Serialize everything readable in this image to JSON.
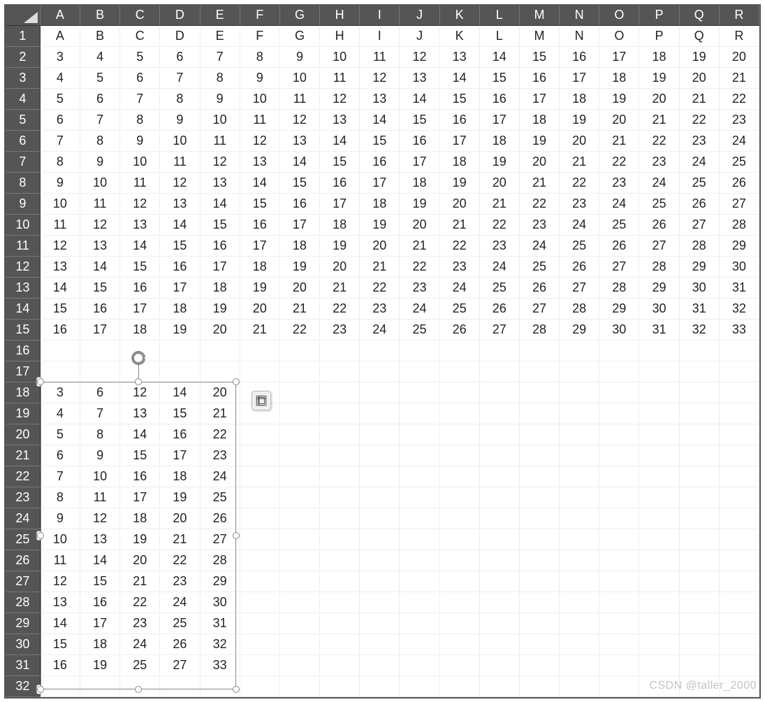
{
  "watermark": "CSDN @taller_2000",
  "columns": [
    "A",
    "B",
    "C",
    "D",
    "E",
    "F",
    "G",
    "H",
    "I",
    "J",
    "K",
    "L",
    "M",
    "N",
    "O",
    "P",
    "Q",
    "R"
  ],
  "rowNumbers": [
    1,
    2,
    3,
    4,
    5,
    6,
    7,
    8,
    9,
    10,
    11,
    12,
    13,
    14,
    15,
    16,
    17,
    18,
    19,
    20,
    21,
    22,
    23,
    24,
    25,
    26,
    27,
    28,
    29,
    30,
    31,
    32
  ],
  "grid": {
    "1": [
      "A",
      "B",
      "C",
      "D",
      "E",
      "F",
      "G",
      "H",
      "I",
      "J",
      "K",
      "L",
      "M",
      "N",
      "O",
      "P",
      "Q",
      "R"
    ],
    "2": [
      "3",
      "4",
      "5",
      "6",
      "7",
      "8",
      "9",
      "10",
      "11",
      "12",
      "13",
      "14",
      "15",
      "16",
      "17",
      "18",
      "19",
      "20"
    ],
    "3": [
      "4",
      "5",
      "6",
      "7",
      "8",
      "9",
      "10",
      "11",
      "12",
      "13",
      "14",
      "15",
      "16",
      "17",
      "18",
      "19",
      "20",
      "21"
    ],
    "4": [
      "5",
      "6",
      "7",
      "8",
      "9",
      "10",
      "11",
      "12",
      "13",
      "14",
      "15",
      "16",
      "17",
      "18",
      "19",
      "20",
      "21",
      "22"
    ],
    "5": [
      "6",
      "7",
      "8",
      "9",
      "10",
      "11",
      "12",
      "13",
      "14",
      "15",
      "16",
      "17",
      "18",
      "19",
      "20",
      "21",
      "22",
      "23"
    ],
    "6": [
      "7",
      "8",
      "9",
      "10",
      "11",
      "12",
      "13",
      "14",
      "15",
      "16",
      "17",
      "18",
      "19",
      "20",
      "21",
      "22",
      "23",
      "24"
    ],
    "7": [
      "8",
      "9",
      "10",
      "11",
      "12",
      "13",
      "14",
      "15",
      "16",
      "17",
      "18",
      "19",
      "20",
      "21",
      "22",
      "23",
      "24",
      "25"
    ],
    "8": [
      "9",
      "10",
      "11",
      "12",
      "13",
      "14",
      "15",
      "16",
      "17",
      "18",
      "19",
      "20",
      "21",
      "22",
      "23",
      "24",
      "25",
      "26"
    ],
    "9": [
      "10",
      "11",
      "12",
      "13",
      "14",
      "15",
      "16",
      "17",
      "18",
      "19",
      "20",
      "21",
      "22",
      "23",
      "24",
      "25",
      "26",
      "27"
    ],
    "10": [
      "11",
      "12",
      "13",
      "14",
      "15",
      "16",
      "17",
      "18",
      "19",
      "20",
      "21",
      "22",
      "23",
      "24",
      "25",
      "26",
      "27",
      "28"
    ],
    "11": [
      "12",
      "13",
      "14",
      "15",
      "16",
      "17",
      "18",
      "19",
      "20",
      "21",
      "22",
      "23",
      "24",
      "25",
      "26",
      "27",
      "28",
      "29"
    ],
    "12": [
      "13",
      "14",
      "15",
      "16",
      "17",
      "18",
      "19",
      "20",
      "21",
      "22",
      "23",
      "24",
      "25",
      "26",
      "27",
      "28",
      "29",
      "30"
    ],
    "13": [
      "14",
      "15",
      "16",
      "17",
      "18",
      "19",
      "20",
      "21",
      "22",
      "23",
      "24",
      "25",
      "26",
      "27",
      "28",
      "29",
      "30",
      "31"
    ],
    "14": [
      "15",
      "16",
      "17",
      "18",
      "19",
      "20",
      "21",
      "22",
      "23",
      "24",
      "25",
      "26",
      "27",
      "28",
      "29",
      "30",
      "31",
      "32"
    ],
    "15": [
      "16",
      "17",
      "18",
      "19",
      "20",
      "21",
      "22",
      "23",
      "24",
      "25",
      "26",
      "27",
      "28",
      "29",
      "30",
      "31",
      "32",
      "33"
    ],
    "16": [
      "",
      "",
      "",
      "",
      "",
      "",
      "",
      "",
      "",
      "",
      "",
      "",
      "",
      "",
      "",
      "",
      "",
      ""
    ],
    "17": [
      "",
      "",
      "",
      "",
      "",
      "",
      "",
      "",
      "",
      "",
      "",
      "",
      "",
      "",
      "",
      "",
      "",
      ""
    ],
    "18": [
      "3",
      "6",
      "12",
      "14",
      "20",
      "",
      "",
      "",
      "",
      "",
      "",
      "",
      "",
      "",
      "",
      "",
      "",
      ""
    ],
    "19": [
      "4",
      "7",
      "13",
      "15",
      "21",
      "",
      "",
      "",
      "",
      "",
      "",
      "",
      "",
      "",
      "",
      "",
      "",
      ""
    ],
    "20": [
      "5",
      "8",
      "14",
      "16",
      "22",
      "",
      "",
      "",
      "",
      "",
      "",
      "",
      "",
      "",
      "",
      "",
      "",
      ""
    ],
    "21": [
      "6",
      "9",
      "15",
      "17",
      "23",
      "",
      "",
      "",
      "",
      "",
      "",
      "",
      "",
      "",
      "",
      "",
      "",
      ""
    ],
    "22": [
      "7",
      "10",
      "16",
      "18",
      "24",
      "",
      "",
      "",
      "",
      "",
      "",
      "",
      "",
      "",
      "",
      "",
      "",
      ""
    ],
    "23": [
      "8",
      "11",
      "17",
      "19",
      "25",
      "",
      "",
      "",
      "",
      "",
      "",
      "",
      "",
      "",
      "",
      "",
      "",
      ""
    ],
    "24": [
      "9",
      "12",
      "18",
      "20",
      "26",
      "",
      "",
      "",
      "",
      "",
      "",
      "",
      "",
      "",
      "",
      "",
      "",
      ""
    ],
    "25": [
      "10",
      "13",
      "19",
      "21",
      "27",
      "",
      "",
      "",
      "",
      "",
      "",
      "",
      "",
      "",
      "",
      "",
      "",
      ""
    ],
    "26": [
      "11",
      "14",
      "20",
      "22",
      "28",
      "",
      "",
      "",
      "",
      "",
      "",
      "",
      "",
      "",
      "",
      "",
      "",
      ""
    ],
    "27": [
      "12",
      "15",
      "21",
      "23",
      "29",
      "",
      "",
      "",
      "",
      "",
      "",
      "",
      "",
      "",
      "",
      "",
      "",
      ""
    ],
    "28": [
      "13",
      "16",
      "22",
      "24",
      "30",
      "",
      "",
      "",
      "",
      "",
      "",
      "",
      "",
      "",
      "",
      "",
      "",
      ""
    ],
    "29": [
      "14",
      "17",
      "23",
      "25",
      "31",
      "",
      "",
      "",
      "",
      "",
      "",
      "",
      "",
      "",
      "",
      "",
      "",
      ""
    ],
    "30": [
      "15",
      "18",
      "24",
      "26",
      "32",
      "",
      "",
      "",
      "",
      "",
      "",
      "",
      "",
      "",
      "",
      "",
      "",
      ""
    ],
    "31": [
      "16",
      "19",
      "25",
      "27",
      "33",
      "",
      "",
      "",
      "",
      "",
      "",
      "",
      "",
      "",
      "",
      "",
      "",
      ""
    ],
    "32": [
      "",
      "",
      "",
      "",
      "",
      "",
      "",
      "",
      "",
      "",
      "",
      "",
      "",
      "",
      "",
      "",
      "",
      ""
    ]
  },
  "selection": {
    "topRow": 18,
    "leftCol": "A",
    "rows": 15,
    "cols": 5
  },
  "icons": {
    "rotate": "rotate-icon",
    "options": "options-icon"
  }
}
